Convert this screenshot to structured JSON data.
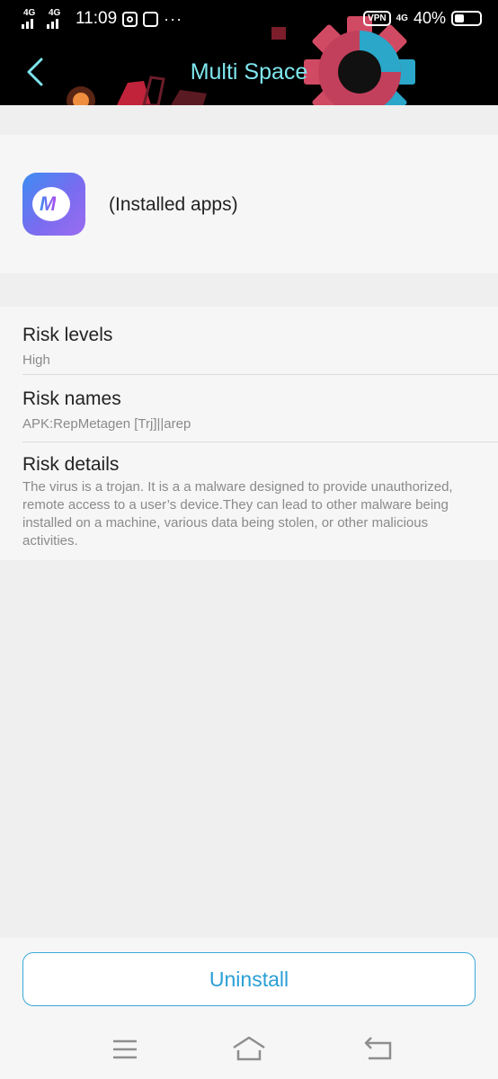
{
  "status_bar": {
    "net1": "4G",
    "net2": "4G",
    "time": "11:09",
    "more": "···",
    "vpn": "VPN",
    "net3": "4G",
    "battery_percent": "40%",
    "battery_level": 0.4
  },
  "header": {
    "title": "Multi Space",
    "back_icon": "chevron-left-icon"
  },
  "app": {
    "icon": "multi-space-app-icon",
    "icon_letter": "M",
    "name": "(Installed apps)"
  },
  "risk": {
    "levels_label": "Risk levels",
    "levels_value": "High",
    "names_label": "Risk names",
    "names_value": "APK:RepMetagen [Trj]||arep",
    "details_label": "Risk details",
    "details_value": "The virus is a trojan. It is a a malware designed to provide unauthorized, remote access to a user’s device.They can lead to other malware being installed on a machine, various data being stolen, or other malicious activities."
  },
  "actions": {
    "uninstall_label": "Uninstall"
  },
  "navbar": {
    "menu_icon": "menu-icon",
    "home_icon": "home-icon",
    "back_icon": "back-arrow-icon"
  },
  "colors": {
    "title": "#7fe6ee",
    "accent": "#2a9fd6",
    "page_bg": "#efefef",
    "card_bg": "#f6f6f6"
  }
}
